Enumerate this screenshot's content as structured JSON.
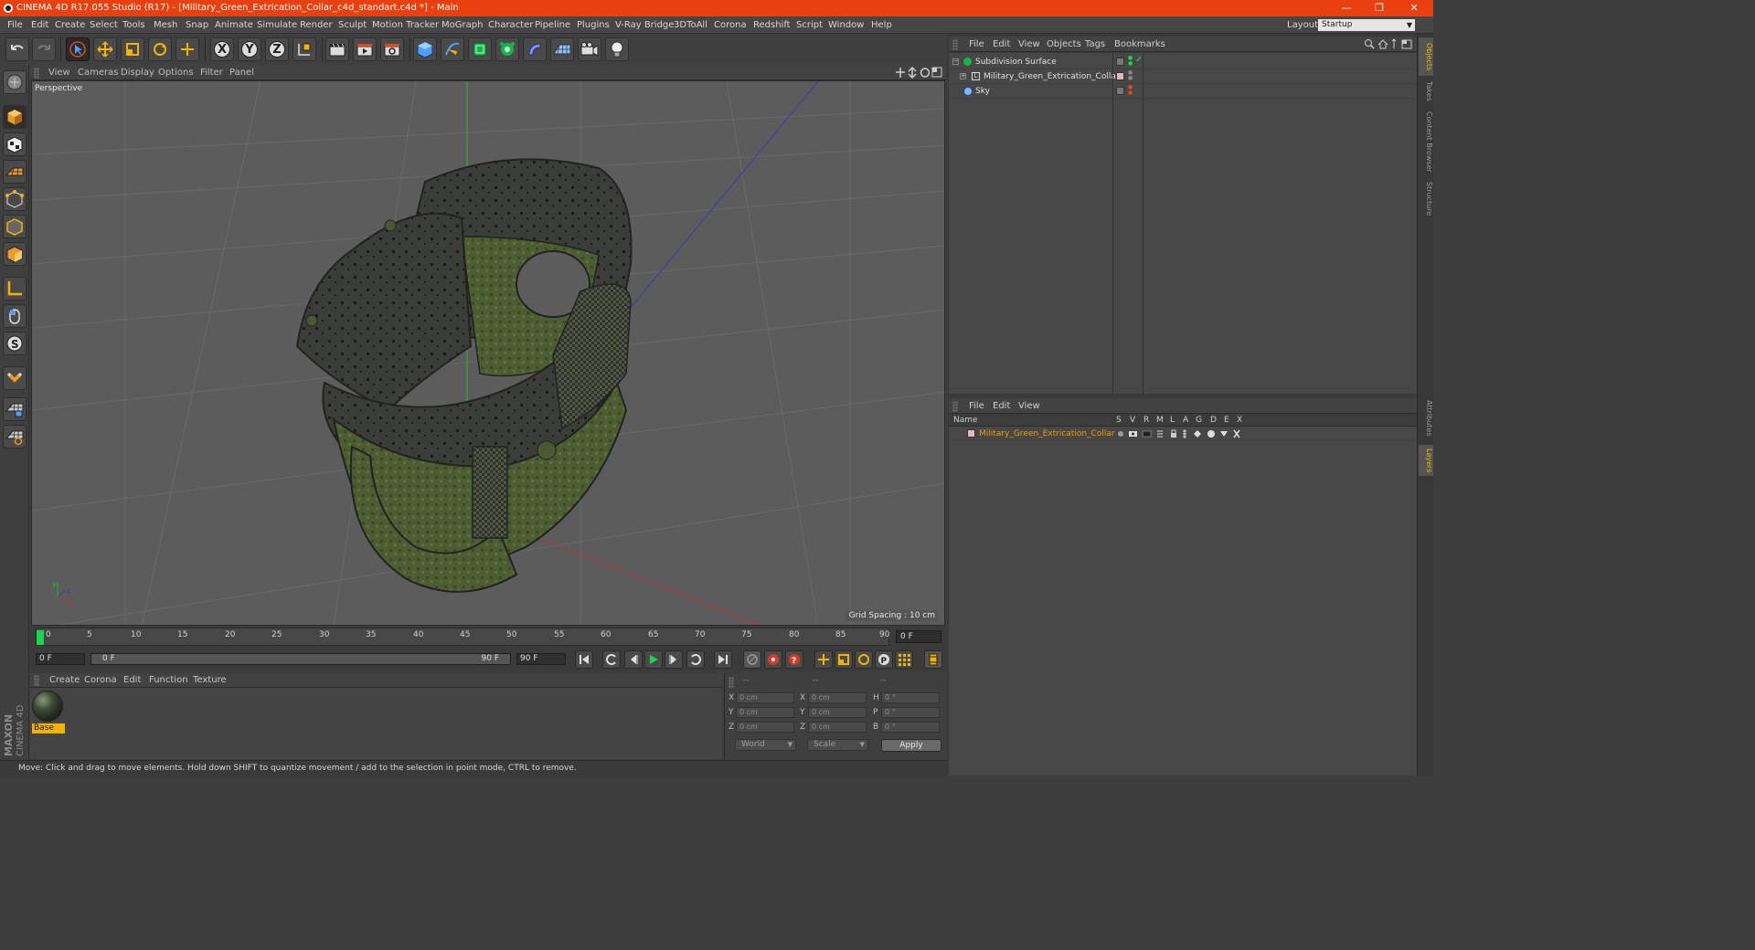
{
  "window": {
    "title": "CINEMA 4D R17.055 Studio (R17) - [Military_Green_Extrication_Collar_c4d_standart.c4d *] - Main",
    "minimize": "—",
    "restore": "❐",
    "close": "✕"
  },
  "menubar": {
    "items": [
      "File",
      "Edit",
      "Create",
      "Select",
      "Tools",
      "Mesh",
      "Snap",
      "Animate",
      "Simulate",
      "Render",
      "Sculpt",
      "Motion Tracker",
      "MoGraph",
      "Character",
      "Pipeline",
      "Plugins",
      "V-Ray Bridge",
      "3DToAll",
      "Corona",
      "Redshift",
      "Script",
      "Window",
      "Help"
    ],
    "layout_label": "Layout:",
    "layout_value": "Startup"
  },
  "toolbar": {
    "axis_x": "X",
    "axis_y": "Y",
    "axis_z": "Z"
  },
  "viewport": {
    "menu": [
      "View",
      "Cameras",
      "Display",
      "Options",
      "Filter",
      "Panel"
    ],
    "camera": "Perspective",
    "grid_spacing": "Grid Spacing : 10 cm",
    "axis_y": "y",
    "axis_z": "z",
    "axis_x": "x"
  },
  "timeline": {
    "ticks": [
      "0",
      "5",
      "10",
      "15",
      "20",
      "25",
      "30",
      "35",
      "40",
      "45",
      "50",
      "55",
      "60",
      "65",
      "70",
      "75",
      "80",
      "85",
      "90"
    ],
    "current_frame": "0 F",
    "start_field": "0 F",
    "range_start": "0 F",
    "range_end": "90 F",
    "end_field": "90 F"
  },
  "material_manager": {
    "menu": [
      "Create",
      "Corona",
      "Edit",
      "Function",
      "Texture"
    ],
    "material_name": "Base"
  },
  "coordinates": {
    "header": [
      "--",
      "--",
      "--"
    ],
    "rows": [
      {
        "a": "X",
        "av": "0 cm",
        "b": "X",
        "bv": "0 cm",
        "c": "H",
        "cv": "0 °"
      },
      {
        "a": "Y",
        "av": "0 cm",
        "b": "Y",
        "bv": "0 cm",
        "c": "P",
        "cv": "0 °"
      },
      {
        "a": "Z",
        "av": "0 cm",
        "b": "Z",
        "bv": "0 cm",
        "c": "B",
        "cv": "0 °"
      }
    ],
    "space": "World",
    "mode": "Scale",
    "apply": "Apply"
  },
  "object_manager": {
    "menu": [
      "File",
      "Edit",
      "View",
      "Objects",
      "Tags",
      "Bookmarks"
    ],
    "objects": [
      "Subdivision Surface",
      "Military_Green_Extrication_Collar",
      "Sky"
    ]
  },
  "layer_manager": {
    "menu": [
      "File",
      "Edit",
      "View"
    ],
    "columns": [
      "Name",
      "S",
      "V",
      "R",
      "M",
      "L",
      "A",
      "G",
      "D",
      "E",
      "X"
    ],
    "layer_name": "Military_Green_Extrication_Collar"
  },
  "side_tabs": [
    "Objects",
    "Takes",
    "Content Browser",
    "Structure",
    "Attributes",
    "Layers"
  ],
  "status": "Move: Click and drag to move elements. Hold down SHIFT to quantize movement / add to the selection in point mode, CTRL to remove.",
  "brand": {
    "maxon": "MAXON",
    "c4d": "CINEMA 4D"
  },
  "colors": {
    "titlebar": "#e8400f",
    "accent": "#f2b400",
    "playhead": "#18d94e",
    "layer_text": "#f29a00"
  }
}
